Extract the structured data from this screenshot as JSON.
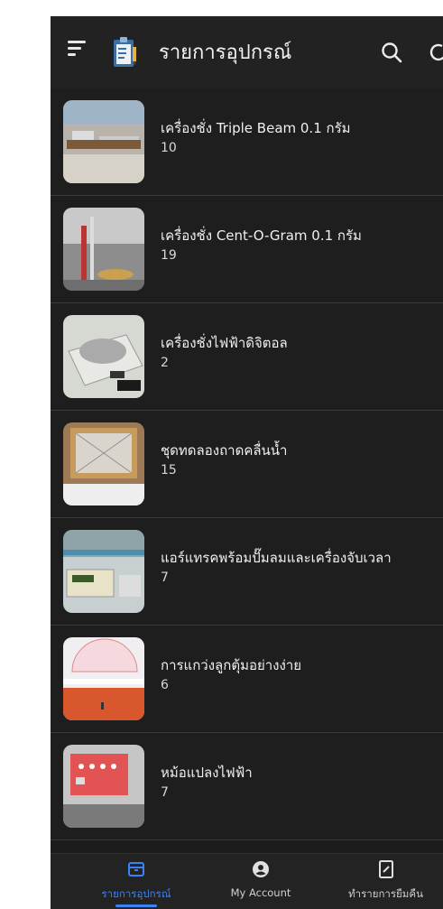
{
  "header": {
    "title": "รายการอุปกรณ์",
    "menu_icon": "menu-icon",
    "logo_icon": "clipboard-logo-icon",
    "search_icon": "search-icon",
    "refresh_icon": "refresh-icon"
  },
  "items": [
    {
      "name": "เครื่องชั่ง Triple Beam 0.1 กรัม",
      "count": "10"
    },
    {
      "name": "เครื่องชั่ง Cent-O-Gram 0.1 กรัม",
      "count": "19"
    },
    {
      "name": "เครื่องชั่งไฟฟ้าดิจิตอล",
      "count": "2"
    },
    {
      "name": "ชุดทดลองถาดคลื่นน้ำ",
      "count": "15"
    },
    {
      "name": "แอร์แทรคพร้อมปั๊มลมและเครื่องจับเวลา",
      "count": "7"
    },
    {
      "name": "การแกว่งลูกตุ้มอย่างง่าย",
      "count": "6"
    },
    {
      "name": "หม้อแปลงไฟฟ้า",
      "count": "7"
    }
  ],
  "bottom_nav": {
    "items": [
      {
        "label": "รายการอุปกรณ์",
        "icon": "archive-icon",
        "active": true
      },
      {
        "label": "My Account",
        "icon": "account-icon",
        "active": false
      },
      {
        "label": "ทำรายการยืมคืน",
        "icon": "edit-document-icon",
        "active": false
      }
    ]
  },
  "colors": {
    "background": "#1c1c1c",
    "appbar": "#222222",
    "active": "#3b82f6",
    "text": "#f0f0f0",
    "inactive": "#bdbdbd"
  }
}
